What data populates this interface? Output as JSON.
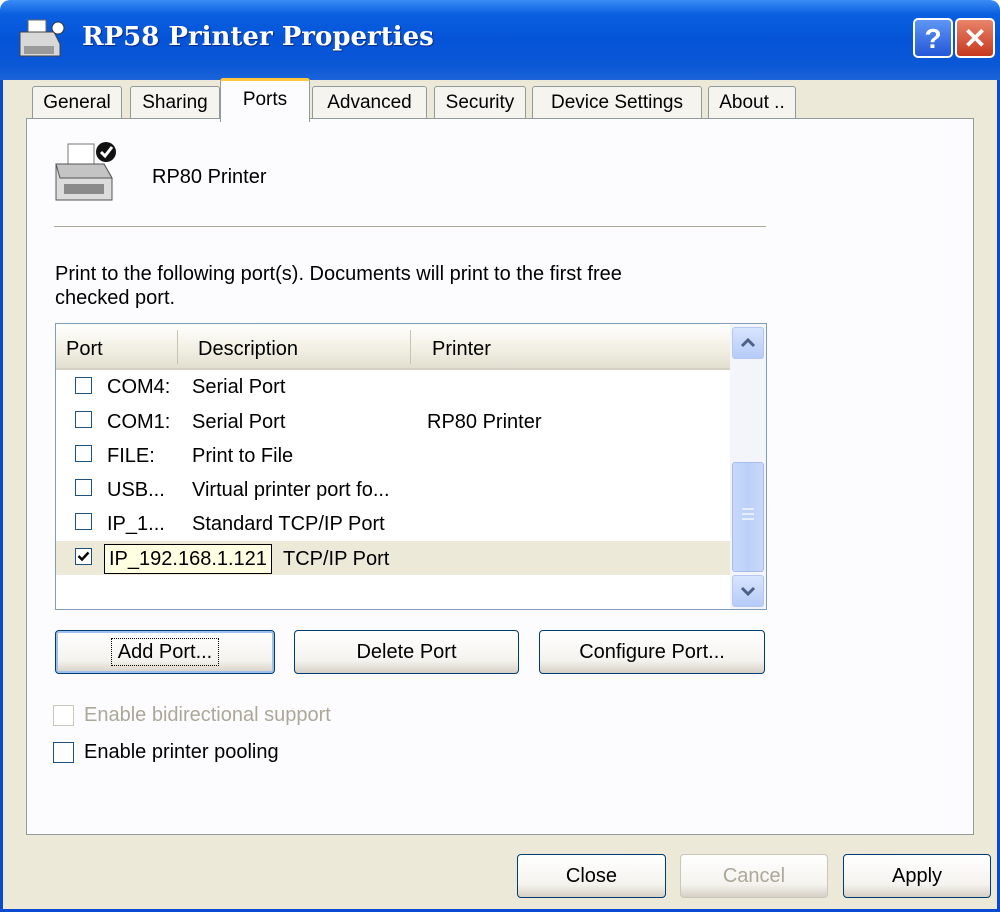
{
  "window": {
    "title": "RP58 Printer Properties",
    "help_glyph": "?",
    "close_glyph": "✕"
  },
  "tabs": [
    {
      "label": "General"
    },
    {
      "label": "Sharing"
    },
    {
      "label": "Ports",
      "active": true
    },
    {
      "label": "Advanced"
    },
    {
      "label": "Security"
    },
    {
      "label": "Device Settings"
    },
    {
      "label": "About .."
    }
  ],
  "printer": {
    "name": "RP80 Printer",
    "icon": "printer-icon"
  },
  "instructions": {
    "line1": "Print to the following port(s). Documents will print to the first free",
    "line2": "checked port."
  },
  "port_list": {
    "columns": [
      "Port",
      "Description",
      "Printer"
    ],
    "rows": [
      {
        "port": "COM4:",
        "description": "Serial Port",
        "printer": "",
        "checked": false
      },
      {
        "port": "COM1:",
        "description": "Serial Port",
        "printer": "RP80 Printer",
        "checked": false
      },
      {
        "port": "FILE:",
        "description": "Print to File",
        "printer": "",
        "checked": false
      },
      {
        "port": "USB...",
        "description": "Virtual printer port fo...",
        "printer": "",
        "checked": false
      },
      {
        "port": "IP_1...",
        "description": "Standard TCP/IP Port",
        "printer": "",
        "checked": false
      },
      {
        "port": "",
        "description": "TCP/IP Port",
        "printer": "",
        "checked": true,
        "selected": true
      }
    ],
    "tooltip": "IP_192.168.1.121"
  },
  "port_buttons": {
    "add": "Add Port...",
    "delete": "Delete Port",
    "configure": "Configure Port..."
  },
  "options": {
    "bidirectional": {
      "label": "Enable bidirectional support",
      "checked": false,
      "enabled": false
    },
    "pooling": {
      "label": "Enable printer pooling",
      "checked": false,
      "enabled": true
    }
  },
  "dialog_buttons": {
    "close": "Close",
    "cancel": "Cancel",
    "apply": "Apply"
  },
  "colors": {
    "titlebar": "#0554d8",
    "dialog_bg": "#ece9d8",
    "active_tab_accent": "#ffc83c",
    "tooltip_bg": "#ffffe1"
  }
}
